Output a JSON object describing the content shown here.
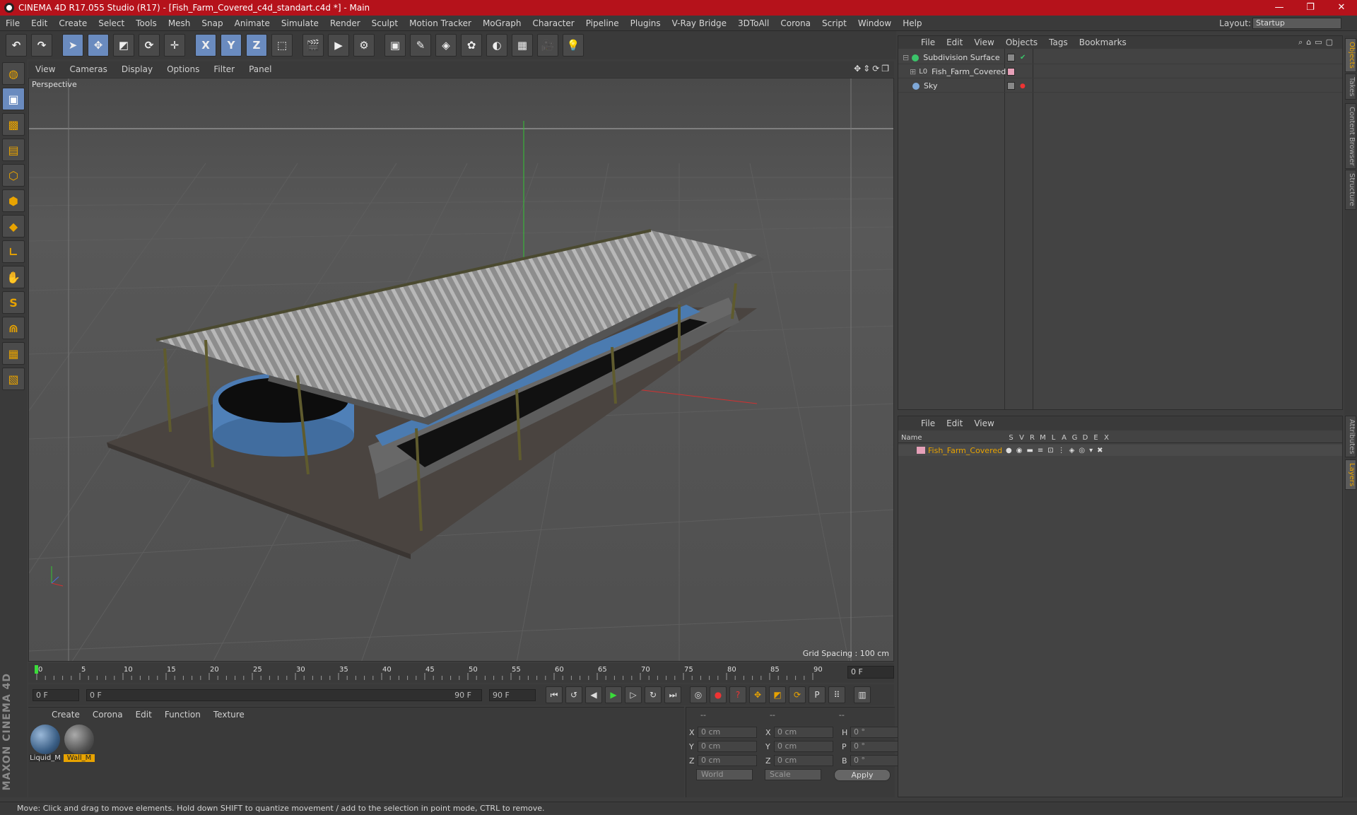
{
  "window": {
    "title": "CINEMA 4D R17.055 Studio (R17) - [Fish_Farm_Covered_c4d_standart.c4d *] - Main"
  },
  "menubar": {
    "items": [
      "File",
      "Edit",
      "Create",
      "Select",
      "Tools",
      "Mesh",
      "Snap",
      "Animate",
      "Simulate",
      "Render",
      "Sculpt",
      "Motion Tracker",
      "MoGraph",
      "Character",
      "Pipeline",
      "Plugins",
      "V-Ray Bridge",
      "3DToAll",
      "Corona",
      "Script",
      "Window",
      "Help"
    ],
    "layout_label": "Layout:",
    "layout_value": "Startup"
  },
  "viewport": {
    "menu": [
      "View",
      "Cameras",
      "Display",
      "Options",
      "Filter",
      "Panel"
    ],
    "label": "Perspective",
    "grid_spacing": "Grid Spacing : 100 cm"
  },
  "timeline": {
    "ticks": [
      "0",
      "5",
      "10",
      "15",
      "20",
      "25",
      "30",
      "35",
      "40",
      "45",
      "50",
      "55",
      "60",
      "65",
      "70",
      "75",
      "80",
      "85",
      "90"
    ],
    "current_frame": "0 F"
  },
  "transport": {
    "start": "0 F",
    "range_start": "0 F",
    "range_end": "90 F",
    "end": "90 F"
  },
  "materials": {
    "menu": [
      "Create",
      "Corona",
      "Edit",
      "Function",
      "Texture"
    ],
    "items": [
      {
        "name": "Liquid_M"
      },
      {
        "name": "Wall_M"
      }
    ]
  },
  "coords": {
    "header": [
      "--",
      "--",
      "--"
    ],
    "rows": [
      {
        "a": "X",
        "v1": "0 cm",
        "b": "X",
        "v2": "0 cm",
        "c": "H",
        "v3": "0 °"
      },
      {
        "a": "Y",
        "v1": "0 cm",
        "b": "Y",
        "v2": "0 cm",
        "c": "P",
        "v3": "0 °"
      },
      {
        "a": "Z",
        "v1": "0 cm",
        "b": "Z",
        "v2": "0 cm",
        "c": "B",
        "v3": "0 °"
      }
    ],
    "world": "World",
    "scale": "Scale",
    "apply": "Apply"
  },
  "objects": {
    "menu": [
      "File",
      "Edit",
      "View",
      "Objects",
      "Tags",
      "Bookmarks"
    ],
    "items": [
      {
        "name": "Subdivision Surface"
      },
      {
        "name": "Fish_Farm_Covered"
      },
      {
        "name": "Sky"
      }
    ]
  },
  "layers": {
    "menu": [
      "File",
      "Edit",
      "View"
    ],
    "header_name": "Name",
    "cols": [
      "S",
      "V",
      "R",
      "M",
      "L",
      "A",
      "G",
      "D",
      "E",
      "X"
    ],
    "row": "Fish_Farm_Covered"
  },
  "sidetabs": [
    "Objects",
    "Takes",
    "Content Browser",
    "Structure",
    "Attributes",
    "Layers"
  ],
  "status": "Move: Click and drag to move elements. Hold down SHIFT to quantize movement / add to the selection in point mode, CTRL to remove.",
  "brand": "MAXON CINEMA 4D",
  "colors": {
    "titlebar": "#b5121b",
    "accent": "#e8a300",
    "selected": "#6a8bbf"
  }
}
